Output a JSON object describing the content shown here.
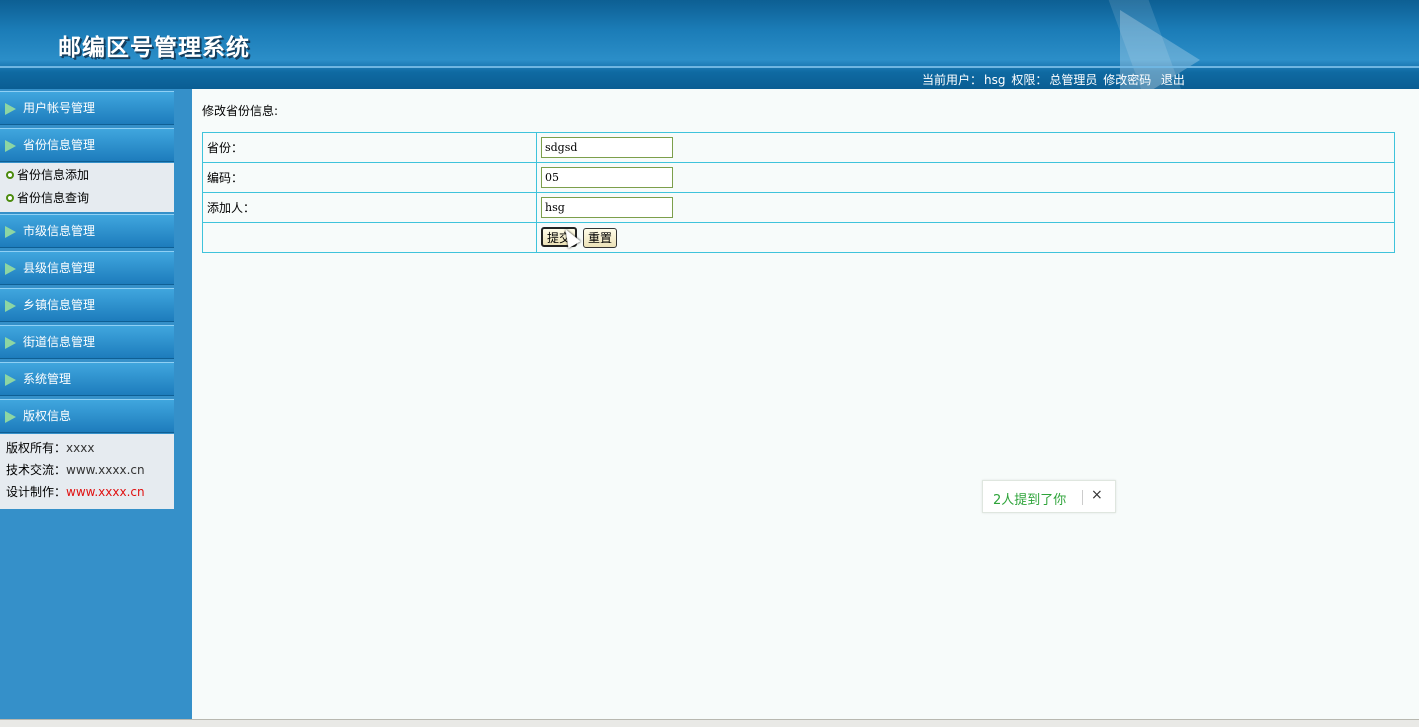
{
  "header": {
    "app_title": "邮编区号管理系统",
    "current_user_label": "当前用户：",
    "current_user": "hsg",
    "permission_label": "权限：",
    "permission": "总管理员",
    "change_password": "修改密码",
    "logout": "退出"
  },
  "sidebar": {
    "menus": [
      {
        "label": "用户帐号管理"
      },
      {
        "label": "省份信息管理"
      },
      {
        "label": "市级信息管理"
      },
      {
        "label": "县级信息管理"
      },
      {
        "label": "乡镇信息管理"
      },
      {
        "label": "街道信息管理"
      },
      {
        "label": "系统管理"
      },
      {
        "label": "版权信息"
      }
    ],
    "province_submenu": [
      {
        "label": "省份信息添加"
      },
      {
        "label": "省份信息查询"
      }
    ],
    "copyright": {
      "owner_label": "版权所有：",
      "owner_value": "xxxx",
      "tech_label": "技术交流：",
      "tech_value": "www.xxxx.cn",
      "design_label": "设计制作：",
      "design_value": "www.xxxx.cn"
    }
  },
  "main": {
    "form_title": "修改省份信息:",
    "fields": {
      "province_label": "省份：",
      "province_value": "sdgsd",
      "code_label": "编码：",
      "code_value": "05",
      "adder_label": "添加人：",
      "adder_value": "hsg"
    },
    "submit_label": "提交",
    "reset_label": "重置"
  },
  "toast": {
    "message": "2人提到了你",
    "close": "×"
  }
}
